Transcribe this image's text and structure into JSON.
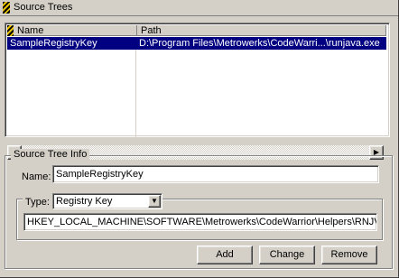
{
  "window": {
    "title": "Source Trees",
    "icon": "striped-panel-icon"
  },
  "list": {
    "columns": [
      "Name",
      "Path"
    ],
    "rows": [
      {
        "name": "SampleRegistryKey",
        "path": "D:\\Program Files\\Metrowerks\\CodeWarri...\\runjava.exe",
        "selected": true
      }
    ],
    "scroll_left_icon": "◀",
    "scroll_right_icon": "▶"
  },
  "group": {
    "legend": "Source Tree Info",
    "name_label": "Name:",
    "name_value": "SampleRegistryKey",
    "type_label": "Type:",
    "type_value": "Registry Key",
    "type_arrow": "▼",
    "key_value": "HKEY_LOCAL_MACHINE\\SOFTWARE\\Metrowerks\\CodeWarrior\\Helpers\\RNJV"
  },
  "buttons": {
    "add": "Add",
    "change": "Change",
    "remove": "Remove"
  },
  "colors": {
    "face": "#d4d0c8",
    "selection": "#000080"
  }
}
